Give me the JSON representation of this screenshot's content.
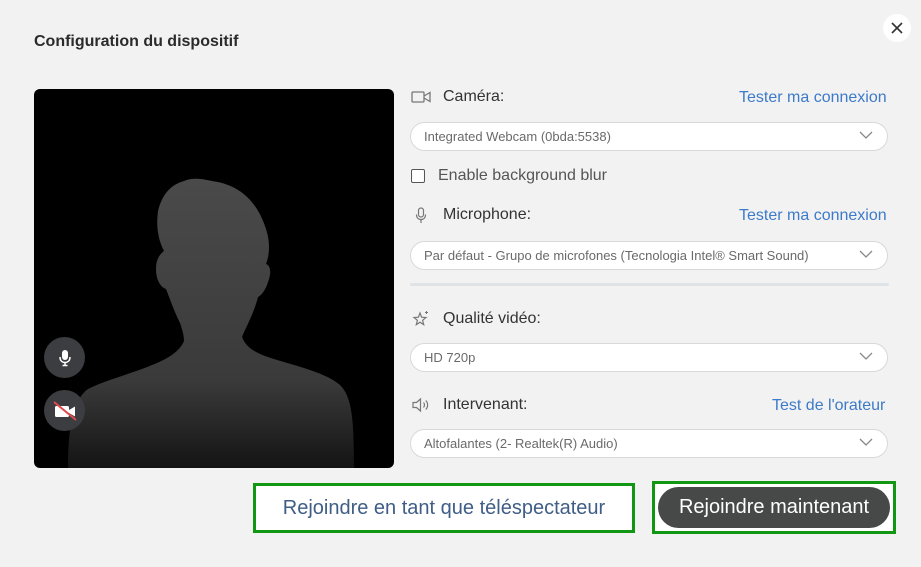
{
  "dialog": {
    "title": "Configuration du dispositif"
  },
  "camera": {
    "label": "Caméra:",
    "test_link": "Tester ma connexion",
    "selected": "Integrated Webcam (0bda:5538)",
    "icon": "video-camera-icon"
  },
  "background_blur": {
    "label": "Enable background blur",
    "checked": false
  },
  "microphone": {
    "label": "Microphone:",
    "test_link": "Tester ma connexion",
    "selected": "Par défaut - Grupo de microfones (Tecnologia Intel® Smart Sound)",
    "icon": "microphone-icon"
  },
  "video_quality": {
    "label": "Qualité vidéo:",
    "selected": "HD 720p",
    "icon": "sparkle-star-icon"
  },
  "speaker": {
    "label": "Intervenant:",
    "test_link": "Test de l'orateur",
    "selected": "Altofalantes (2- Realtek(R) Audio)",
    "icon": "speaker-icon"
  },
  "buttons": {
    "join_as_viewer": "Rejoindre en tant que téléspectateur",
    "join_now": "Rejoindre maintenant"
  },
  "colors": {
    "link": "#3d7ac9",
    "highlight": "#129712",
    "join_button": "#474848"
  }
}
